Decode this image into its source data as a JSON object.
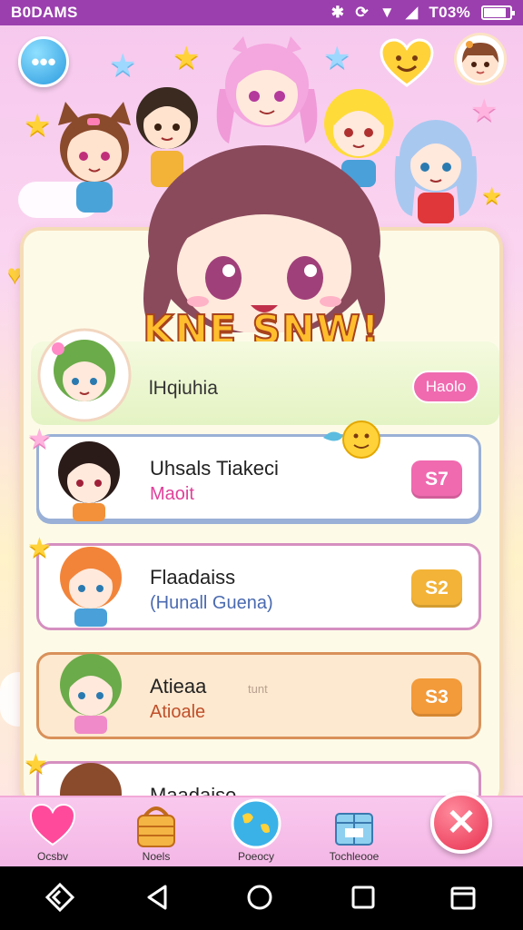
{
  "status_bar": {
    "left_text": "B0DAMS",
    "battery": "T03%",
    "battery_fraction": 0.8
  },
  "title": "KNE SNW!",
  "header_row": {
    "label": "lHqiuhia",
    "button": "Haolo"
  },
  "rows": [
    {
      "name": "Uhsals Tiakeci",
      "sub": "Maoit",
      "badge": "S7",
      "badge_color": "#f06ab0",
      "border": "#9ab0d6"
    },
    {
      "name": "Flaadaiss",
      "sub": "(Hunall Guena)",
      "badge": "S2",
      "badge_color": "#f2b338",
      "border": "#d58fc0"
    },
    {
      "name": "Atieaa",
      "sub": "Atioale",
      "badge": "S3",
      "badge_color": "#f39a3a",
      "border": "#d9915a"
    },
    {
      "name": "Maadaise",
      "sub": "",
      "badge": "",
      "badge_color": "#f2b338",
      "border": "#d58fc0"
    }
  ],
  "row3_note": "tunt",
  "bottom_nav": [
    {
      "label": "Ocsbv",
      "icon": "heart-icon"
    },
    {
      "label": "Noels",
      "icon": "basket-icon"
    },
    {
      "label": "Poeocy",
      "icon": "globe-icon"
    },
    {
      "label": "Tochleooe",
      "icon": "gift-box-icon"
    }
  ],
  "colors": {
    "accent_purple": "#9b3fae",
    "pink": "#f06ab0",
    "gold": "#ffbe2e"
  }
}
